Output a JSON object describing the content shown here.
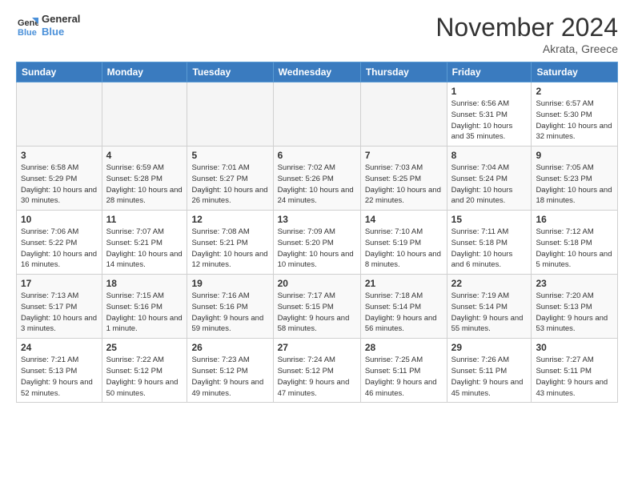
{
  "logo": {
    "line1": "General",
    "line2": "Blue"
  },
  "title": "November 2024",
  "location": "Akrata, Greece",
  "weekdays": [
    "Sunday",
    "Monday",
    "Tuesday",
    "Wednesday",
    "Thursday",
    "Friday",
    "Saturday"
  ],
  "weeks": [
    [
      {
        "day": "",
        "empty": true
      },
      {
        "day": "",
        "empty": true
      },
      {
        "day": "",
        "empty": true
      },
      {
        "day": "",
        "empty": true
      },
      {
        "day": "",
        "empty": true
      },
      {
        "day": "1",
        "sunrise": "6:56 AM",
        "sunset": "5:31 PM",
        "daylight": "10 hours and 35 minutes."
      },
      {
        "day": "2",
        "sunrise": "6:57 AM",
        "sunset": "5:30 PM",
        "daylight": "10 hours and 32 minutes."
      }
    ],
    [
      {
        "day": "3",
        "sunrise": "6:58 AM",
        "sunset": "5:29 PM",
        "daylight": "10 hours and 30 minutes."
      },
      {
        "day": "4",
        "sunrise": "6:59 AM",
        "sunset": "5:28 PM",
        "daylight": "10 hours and 28 minutes."
      },
      {
        "day": "5",
        "sunrise": "7:01 AM",
        "sunset": "5:27 PM",
        "daylight": "10 hours and 26 minutes."
      },
      {
        "day": "6",
        "sunrise": "7:02 AM",
        "sunset": "5:26 PM",
        "daylight": "10 hours and 24 minutes."
      },
      {
        "day": "7",
        "sunrise": "7:03 AM",
        "sunset": "5:25 PM",
        "daylight": "10 hours and 22 minutes."
      },
      {
        "day": "8",
        "sunrise": "7:04 AM",
        "sunset": "5:24 PM",
        "daylight": "10 hours and 20 minutes."
      },
      {
        "day": "9",
        "sunrise": "7:05 AM",
        "sunset": "5:23 PM",
        "daylight": "10 hours and 18 minutes."
      }
    ],
    [
      {
        "day": "10",
        "sunrise": "7:06 AM",
        "sunset": "5:22 PM",
        "daylight": "10 hours and 16 minutes."
      },
      {
        "day": "11",
        "sunrise": "7:07 AM",
        "sunset": "5:21 PM",
        "daylight": "10 hours and 14 minutes."
      },
      {
        "day": "12",
        "sunrise": "7:08 AM",
        "sunset": "5:21 PM",
        "daylight": "10 hours and 12 minutes."
      },
      {
        "day": "13",
        "sunrise": "7:09 AM",
        "sunset": "5:20 PM",
        "daylight": "10 hours and 10 minutes."
      },
      {
        "day": "14",
        "sunrise": "7:10 AM",
        "sunset": "5:19 PM",
        "daylight": "10 hours and 8 minutes."
      },
      {
        "day": "15",
        "sunrise": "7:11 AM",
        "sunset": "5:18 PM",
        "daylight": "10 hours and 6 minutes."
      },
      {
        "day": "16",
        "sunrise": "7:12 AM",
        "sunset": "5:18 PM",
        "daylight": "10 hours and 5 minutes."
      }
    ],
    [
      {
        "day": "17",
        "sunrise": "7:13 AM",
        "sunset": "5:17 PM",
        "daylight": "10 hours and 3 minutes."
      },
      {
        "day": "18",
        "sunrise": "7:15 AM",
        "sunset": "5:16 PM",
        "daylight": "10 hours and 1 minute."
      },
      {
        "day": "19",
        "sunrise": "7:16 AM",
        "sunset": "5:16 PM",
        "daylight": "9 hours and 59 minutes."
      },
      {
        "day": "20",
        "sunrise": "7:17 AM",
        "sunset": "5:15 PM",
        "daylight": "9 hours and 58 minutes."
      },
      {
        "day": "21",
        "sunrise": "7:18 AM",
        "sunset": "5:14 PM",
        "daylight": "9 hours and 56 minutes."
      },
      {
        "day": "22",
        "sunrise": "7:19 AM",
        "sunset": "5:14 PM",
        "daylight": "9 hours and 55 minutes."
      },
      {
        "day": "23",
        "sunrise": "7:20 AM",
        "sunset": "5:13 PM",
        "daylight": "9 hours and 53 minutes."
      }
    ],
    [
      {
        "day": "24",
        "sunrise": "7:21 AM",
        "sunset": "5:13 PM",
        "daylight": "9 hours and 52 minutes."
      },
      {
        "day": "25",
        "sunrise": "7:22 AM",
        "sunset": "5:12 PM",
        "daylight": "9 hours and 50 minutes."
      },
      {
        "day": "26",
        "sunrise": "7:23 AM",
        "sunset": "5:12 PM",
        "daylight": "9 hours and 49 minutes."
      },
      {
        "day": "27",
        "sunrise": "7:24 AM",
        "sunset": "5:12 PM",
        "daylight": "9 hours and 47 minutes."
      },
      {
        "day": "28",
        "sunrise": "7:25 AM",
        "sunset": "5:11 PM",
        "daylight": "9 hours and 46 minutes."
      },
      {
        "day": "29",
        "sunrise": "7:26 AM",
        "sunset": "5:11 PM",
        "daylight": "9 hours and 45 minutes."
      },
      {
        "day": "30",
        "sunrise": "7:27 AM",
        "sunset": "5:11 PM",
        "daylight": "9 hours and 43 minutes."
      }
    ]
  ]
}
